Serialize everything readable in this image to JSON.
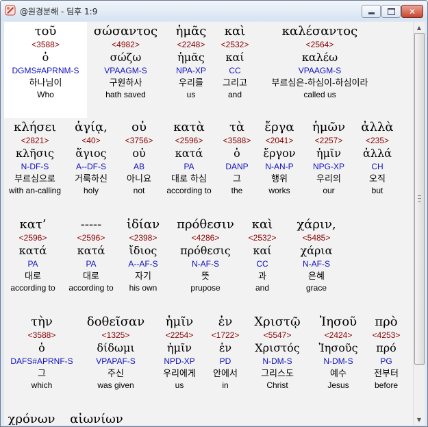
{
  "window": {
    "title": "@원경분해 - 딤후 1:9"
  },
  "rows": [
    {
      "words": [
        {
          "greek": "τοῦ",
          "strong": "<3588>",
          "lemma": "ὁ",
          "morph": "DGMS#APRNM-S",
          "korean": "하나님이",
          "english": "Who",
          "highlight": true
        },
        {
          "greek": "σώσαντος",
          "strong": "<4982>",
          "lemma": "σώζω",
          "morph": "VPAAGM-S",
          "korean": "구원하사",
          "english": "hath saved"
        },
        {
          "greek": "ἡμᾶς",
          "strong": "<2248>",
          "lemma": "ἡμᾶς",
          "morph": "NPA-XP",
          "korean": "우리를",
          "english": "us"
        },
        {
          "greek": "καὶ",
          "strong": "<2532>",
          "lemma": "καί",
          "morph": "CC",
          "korean": "그리고",
          "english": "and"
        },
        {
          "greek": "καλέσαντος",
          "strong": "<2564>",
          "lemma": "καλέω",
          "morph": "VPAAGM-S",
          "korean": "부르심은-하심이-하심이라",
          "english": "called us"
        }
      ]
    },
    {
      "words": [
        {
          "greek": "κλήσει",
          "strong": "<2821>",
          "lemma": "κλῆσις",
          "morph": "N-DF-S",
          "korean": "부르심으로",
          "english": "with an-calling"
        },
        {
          "greek": "ἁγίᾳ,",
          "strong": "<40>",
          "lemma": "ἅγιος",
          "morph": "A--DF-S",
          "korean": "거룩하신",
          "english": "holy"
        },
        {
          "greek": "οὐ",
          "strong": "<3756>",
          "lemma": "οὐ",
          "morph": "AB",
          "korean": "아니요",
          "english": "not"
        },
        {
          "greek": "κατὰ",
          "strong": "<2596>",
          "lemma": "κατά",
          "morph": "PA",
          "korean": "대로 하심",
          "english": "according to"
        },
        {
          "greek": "τὰ",
          "strong": "<3588>",
          "lemma": "ὁ",
          "morph": "DANP",
          "korean": "그",
          "english": "the"
        },
        {
          "greek": "ἔργα",
          "strong": "<2041>",
          "lemma": "ἔργον",
          "morph": "N-AN-P",
          "korean": "행위",
          "english": "works"
        },
        {
          "greek": "ἡμῶν",
          "strong": "<2257>",
          "lemma": "ἡμῖν",
          "morph": "NPG-XP",
          "korean": "우리의",
          "english": "our"
        },
        {
          "greek": "ἀλλὰ",
          "strong": "<235>",
          "lemma": "ἀλλά",
          "morph": "CH",
          "korean": "오직",
          "english": "but"
        }
      ]
    },
    {
      "words": [
        {
          "greek": "κατ’",
          "strong": "<2596>",
          "lemma": "κατά",
          "morph": "PA",
          "korean": "대로",
          "english": "according to"
        },
        {
          "greek": "-----",
          "strong": "<2596>",
          "lemma": "κατά",
          "morph": "PA",
          "korean": "대로",
          "english": "according to"
        },
        {
          "greek": "ἰδίαν",
          "strong": "<2398>",
          "lemma": "ἴδιος",
          "morph": "A--AF-S",
          "korean": "자기",
          "english": "his own"
        },
        {
          "greek": "πρόθεσιν",
          "strong": "<4286>",
          "lemma": "πρόθεσις",
          "morph": "N-AF-S",
          "korean": "뜻",
          "english": "prupose"
        },
        {
          "greek": "καὶ",
          "strong": "<2532>",
          "lemma": "καί",
          "morph": "CC",
          "korean": "과",
          "english": "and"
        },
        {
          "greek": "χάριν,",
          "strong": "<5485>",
          "lemma": "χάρια",
          "morph": "N-AF-S",
          "korean": "은혜",
          "english": "grace"
        }
      ]
    },
    {
      "words": [
        {
          "greek": "τὴν",
          "strong": "<3588>",
          "lemma": "ὁ",
          "morph": "DAFS#APRNF-S",
          "korean": "그",
          "english": "which"
        },
        {
          "greek": "δοθεῖσαν",
          "strong": "<1325>",
          "lemma": "δίδωμι",
          "morph": "VPAPAF-S",
          "korean": "주신",
          "english": "was given"
        },
        {
          "greek": "ἡμῖν",
          "strong": "<2254>",
          "lemma": "ἡμῖν",
          "morph": "NPD-XP",
          "korean": "우리에게",
          "english": "us"
        },
        {
          "greek": "ἐν",
          "strong": "<1722>",
          "lemma": "ἐν",
          "morph": "PD",
          "korean": "안에서",
          "english": "in"
        },
        {
          "greek": "Χριστῷ",
          "strong": "<5547>",
          "lemma": "Χριστός",
          "morph": "N-DM-S",
          "korean": "그리스도",
          "english": "Christ"
        },
        {
          "greek": "Ἰησοῦ",
          "strong": "<2424>",
          "lemma": "Ἰησοῦς",
          "morph": "N-DM-S",
          "korean": "예수",
          "english": "Jesus"
        },
        {
          "greek": "πρὸ",
          "strong": "<4253>",
          "lemma": "πρό",
          "morph": "PG",
          "korean": "전부터",
          "english": "before"
        }
      ]
    },
    {
      "words": [
        {
          "greek": "χρόνων"
        },
        {
          "greek": "αἰωνίων"
        }
      ]
    }
  ]
}
